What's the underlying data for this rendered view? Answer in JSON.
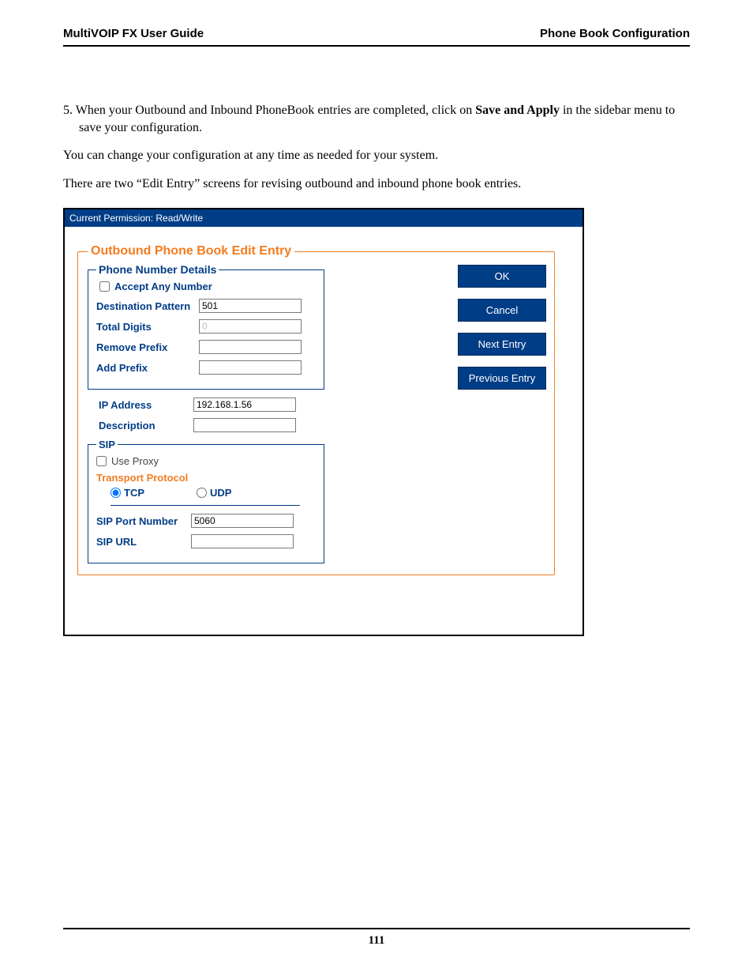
{
  "header": {
    "left": "MultiVOIP FX User Guide",
    "right": "Phone Book Configuration"
  },
  "body": {
    "p1_prefix": "5. When your Outbound and Inbound PhoneBook entries are completed, click on ",
    "p1_bold": "Save and Apply",
    "p1_suffix": " in the sidebar menu to save your configuration.",
    "p2": "You can change your configuration at any time as needed for your system.",
    "p3": "There are two “Edit Entry” screens for revising outbound and inbound phone book entries."
  },
  "window": {
    "permission": "Current Permission:  Read/Write",
    "title": "Outbound Phone Book Edit Entry",
    "pnd": {
      "legend": "Phone Number Details",
      "accept_any": "Accept Any Number",
      "accept_any_checked": false,
      "dest_pattern_label": "Destination Pattern",
      "dest_pattern_value": "501",
      "total_digits_label": "Total Digits",
      "total_digits_placeholder": "0",
      "total_digits_value": "",
      "remove_prefix_label": "Remove Prefix",
      "remove_prefix_value": "",
      "add_prefix_label": "Add Prefix",
      "add_prefix_value": ""
    },
    "ip_label": "IP Address",
    "ip_value": "192.168.1.56",
    "desc_label": "Description",
    "desc_value": "",
    "sip": {
      "legend": "SIP",
      "use_proxy": "Use Proxy",
      "use_proxy_checked": false,
      "tp_label": "Transport Protocol",
      "tcp": "TCP",
      "udp": "UDP",
      "tp_selected": "TCP",
      "port_label": "SIP Port Number",
      "port_value": "5060",
      "url_label": "SIP URL",
      "url_value": ""
    },
    "buttons": {
      "ok": "OK",
      "cancel": "Cancel",
      "next": "Next Entry",
      "prev": "Previous Entry"
    }
  },
  "page_number": "111"
}
